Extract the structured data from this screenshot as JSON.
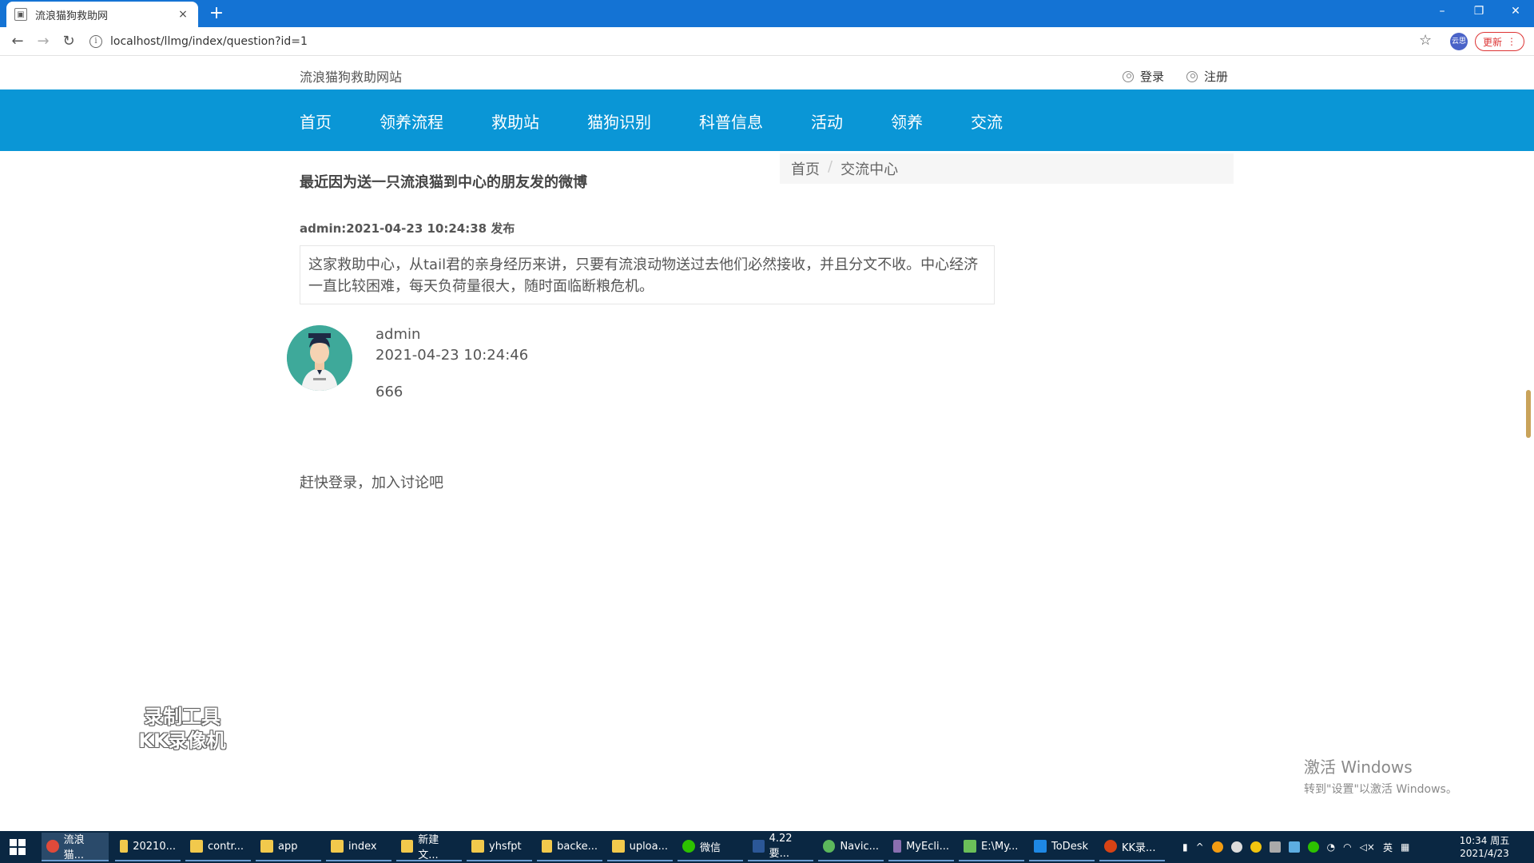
{
  "browser": {
    "tab_title": "流浪猫狗救助网",
    "tab_close": "×",
    "new_tab": "+",
    "url": "localhost/llmg/index/question?id=1",
    "update_label": "更新",
    "profile_label": "云思",
    "window_controls": [
      "–",
      "❐",
      "✕"
    ]
  },
  "site": {
    "name": "流浪猫狗救助网站",
    "login": "登录",
    "register": "注册",
    "nav": [
      "首页",
      "领养流程",
      "救助站",
      "猫狗识别",
      "科普信息",
      "活动",
      "领养",
      "交流"
    ]
  },
  "breadcrumb": {
    "home": "首页",
    "sep": "/",
    "current": "交流中心"
  },
  "post": {
    "title": "最近因为送一只流浪猫到中心的朋友发的微博",
    "meta": "admin:2021-04-23 10:24:38 发布",
    "body": "这家救助中心，从tail君的亲身经历来讲，只要有流浪动物送过去他们必然接收，并且分文不收。中心经济一直比较困难，每天负荷量很大，随时面临断粮危机。"
  },
  "comment": {
    "user": "admin",
    "time": "2021-04-23 10:24:46",
    "text": "666"
  },
  "login_prompt": "赶快登录，加入讨论吧",
  "watermark": {
    "line1": "录制工具",
    "line2": "KK录像机"
  },
  "activation": {
    "line1": "激活 Windows",
    "line2": "转到\"设置\"以激活 Windows。"
  },
  "taskbar": {
    "items": [
      "流浪猫...",
      "20210...",
      "contr...",
      "app",
      "index",
      "新建文...",
      "yhsfpt",
      "backe...",
      "uploa...",
      "微信",
      "4.22要...",
      "Navic...",
      "MyEcli...",
      "E:\\My...",
      "ToDesk",
      "KK录..."
    ],
    "ime": "英",
    "time": "10:34 周五",
    "date": "2021/4/23"
  },
  "colors": {
    "nav_bg": "#0a96d6",
    "titlebar": "#1473d4",
    "taskbar": "#0a2742"
  }
}
